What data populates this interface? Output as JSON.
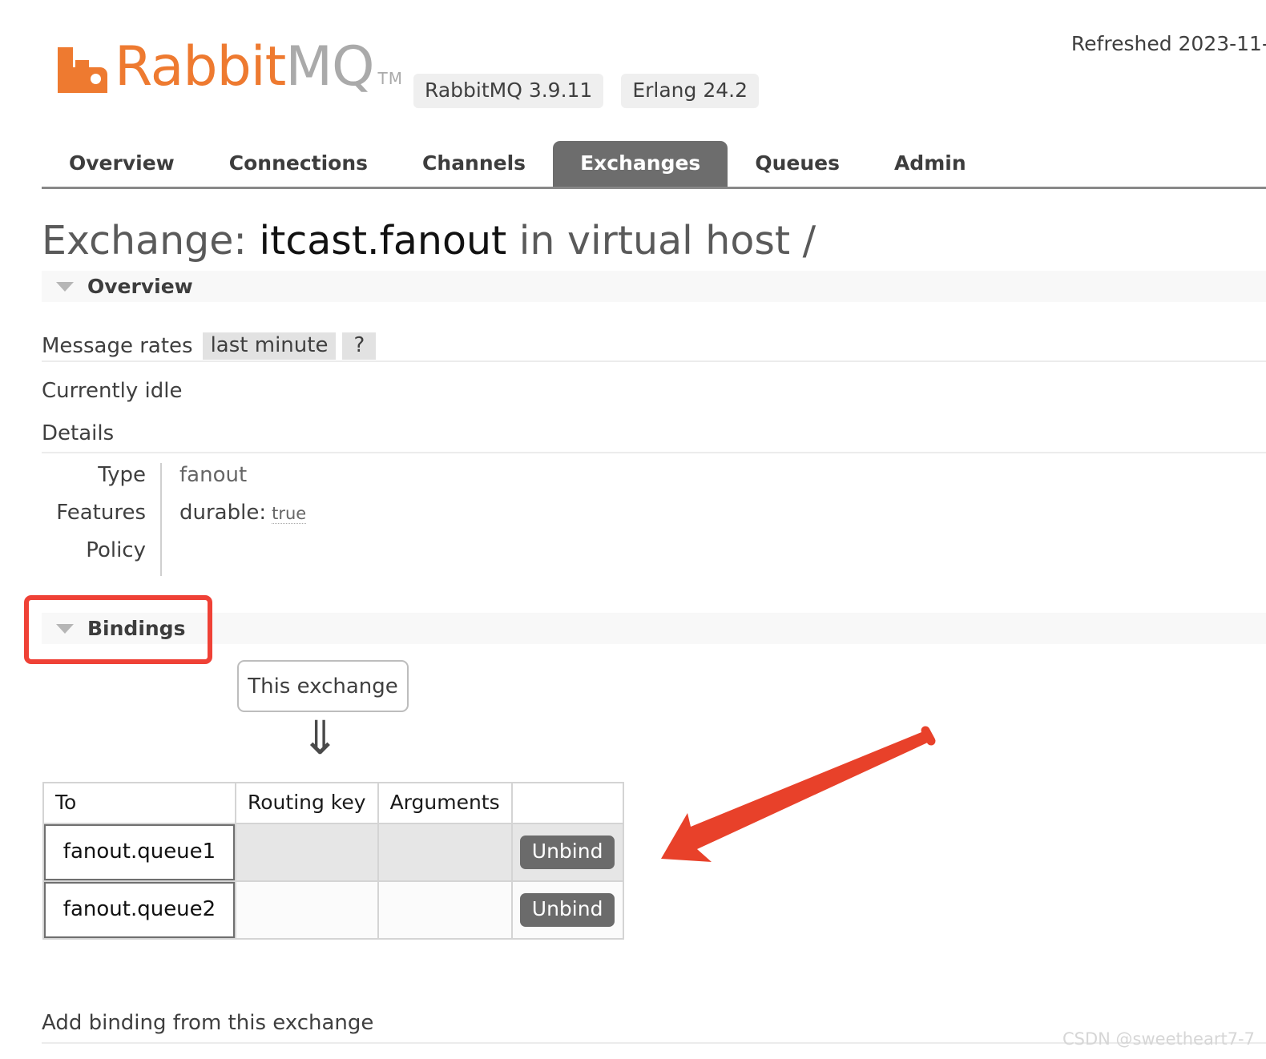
{
  "header": {
    "refreshed": "Refreshed 2023-11-",
    "logo_rabbit": "Rabbit",
    "logo_mq": "MQ",
    "logo_tm": "TM",
    "badges": [
      {
        "label": "RabbitMQ 3.9.11"
      },
      {
        "label": "Erlang 24.2"
      }
    ]
  },
  "nav": {
    "tabs": [
      {
        "label": "Overview",
        "active": false
      },
      {
        "label": "Connections",
        "active": false
      },
      {
        "label": "Channels",
        "active": false
      },
      {
        "label": "Exchanges",
        "active": true
      },
      {
        "label": "Queues",
        "active": false
      },
      {
        "label": "Admin",
        "active": false
      }
    ]
  },
  "page": {
    "title_prefix": "Exchange: ",
    "title_name": "itcast.fanout",
    "title_suffix": " in virtual host /"
  },
  "overview": {
    "section_label": "Overview",
    "message_rates_label": "Message rates",
    "period_chip": "last minute",
    "help_chip": "?",
    "status": "Currently idle",
    "details_label": "Details",
    "details": [
      {
        "key": "Type",
        "value": "fanout",
        "extra": ""
      },
      {
        "key": "Features",
        "value": "durable:",
        "extra": "true"
      },
      {
        "key": "Policy",
        "value": "",
        "extra": ""
      }
    ]
  },
  "bindings": {
    "section_label": "Bindings",
    "source_box_label": "This exchange",
    "flow_arrow_glyph": "⇓",
    "columns": [
      "To",
      "Routing key",
      "Arguments",
      ""
    ],
    "rows": [
      {
        "to": "fanout.queue1",
        "routing_key": "",
        "arguments": "",
        "action": "Unbind"
      },
      {
        "to": "fanout.queue2",
        "routing_key": "",
        "arguments": "",
        "action": "Unbind"
      }
    ],
    "add_binding_label": "Add binding from this exchange"
  },
  "annotations": {
    "highlight_color": "#ef4136",
    "arrow_color": "#e8412a"
  },
  "watermark": "CSDN @sweetheart7-7"
}
